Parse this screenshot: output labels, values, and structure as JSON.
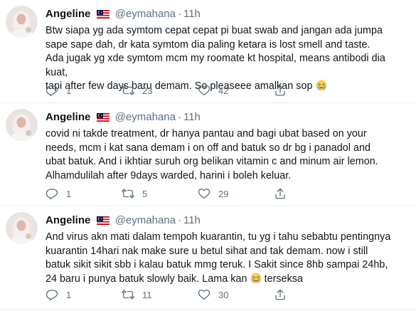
{
  "tweets": [
    {
      "name": "Angeline",
      "handle": "@eymahana",
      "dot": "·",
      "time": "11h",
      "lines": [
        "Btw siapa yg ada symtom cepat cepat pi buat swab and jangan ada jumpa",
        "sape sape dah, dr kata symtom dia paling ketara is lost smell and taste.",
        "Ada jugak yg xde symtom mcm my roomate kt hospital, means antibodi dia kuat,",
        "tapi after few days baru demam. So pleaseee amalkan sop"
      ],
      "replies": "1",
      "retweets": "23",
      "likes": "42"
    },
    {
      "name": "Angeline",
      "handle": "@eymahana",
      "dot": "·",
      "time": "11h",
      "lines": [
        "covid ni takde treatment, dr hanya pantau and bagi ubat based on your",
        "needs, mcm i kat sana demam i on off and batuk so dr bg i panadol and",
        "ubat batuk. And i ikhtiar suruh org belikan vitamin c and minum air lemon.",
        "Alhamdulilah after 9days warded, harini i boleh keluar."
      ],
      "replies": "1",
      "retweets": "5",
      "likes": "29"
    },
    {
      "name": "Angeline",
      "handle": "@eymahana",
      "dot": "·",
      "time": "11h",
      "lines": [
        "And virus akn mati dalam tempoh kuarantin, tu yg i tahu sebabtu pentingnya",
        "kuarantin 14hari nak make sure u betul sihat and tak demam. now i still",
        "batuk sikit sikit sbb i kalau batuk mmg teruk. I Sakit since 8hb sampai 24hb,",
        "24 baru i punya batuk slowly baik. Lama kan",
        "terseksa"
      ],
      "replies": "1",
      "retweets": "11",
      "likes": "30"
    }
  ],
  "icons": {
    "reply": "reply-icon",
    "retweet": "retweet-icon",
    "like": "heart-icon",
    "share": "share-icon",
    "flag": "malaysia-flag-icon",
    "emoji": "crying-face-emoji"
  },
  "colors": {
    "text": "#0f1419",
    "muted": "#5b7083",
    "divider": "#e6ecf0"
  }
}
